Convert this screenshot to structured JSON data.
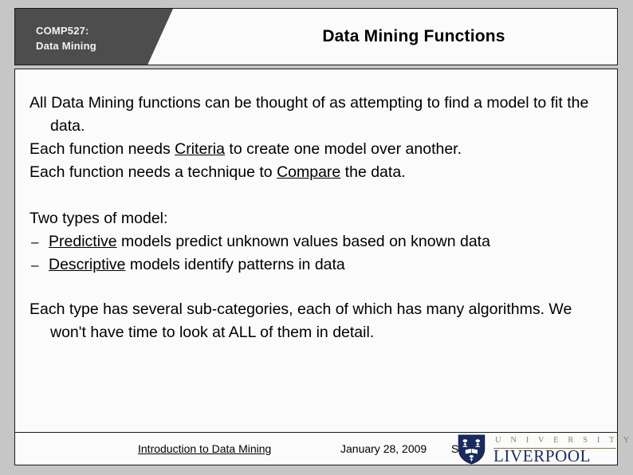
{
  "slide": {
    "course_tab": "COMP527:\nData Mining",
    "title": "Data Mining Functions"
  },
  "body": {
    "paragraph_1": "All Data Mining functions can be thought of as attempting to find a model to fit the data.",
    "paragraph_2_pre": "Each function needs ",
    "paragraph_2_underlined": "Criteria",
    "paragraph_2_post": " to create one model over another.",
    "paragraph_3_pre": "Each function needs a technique to ",
    "paragraph_3_underlined": "Compare",
    "paragraph_3_post": " the data.",
    "list_heading": "Two types of model:",
    "bullet_marker": "–",
    "bullets": [
      {
        "underlined": "Predictive",
        "rest": " models predict unknown values based on known data"
      },
      {
        "underlined": "Descriptive",
        "rest": " models identify patterns in data"
      }
    ],
    "paragraph_4": "Each type has several sub-categories, each of which has many algorithms.  We won't have time to look at ALL of them in detail."
  },
  "footer": {
    "document_title": "Introduction to Data Mining",
    "date": "January 28, 2009",
    "page_number": "S",
    "logo": {
      "line1": "U N I V E R S I T Y   O F",
      "line2": "LIVERPOOL"
    }
  },
  "colors": {
    "page_background": "#c6c6c6",
    "panel_background": "#fbfbfb",
    "tab_background": "#4d4d4d",
    "tab_text": "#f2f2f2",
    "border": "#1a1a1a",
    "logo_navy": "#1b2a5e",
    "logo_gold": "#8f8257"
  }
}
